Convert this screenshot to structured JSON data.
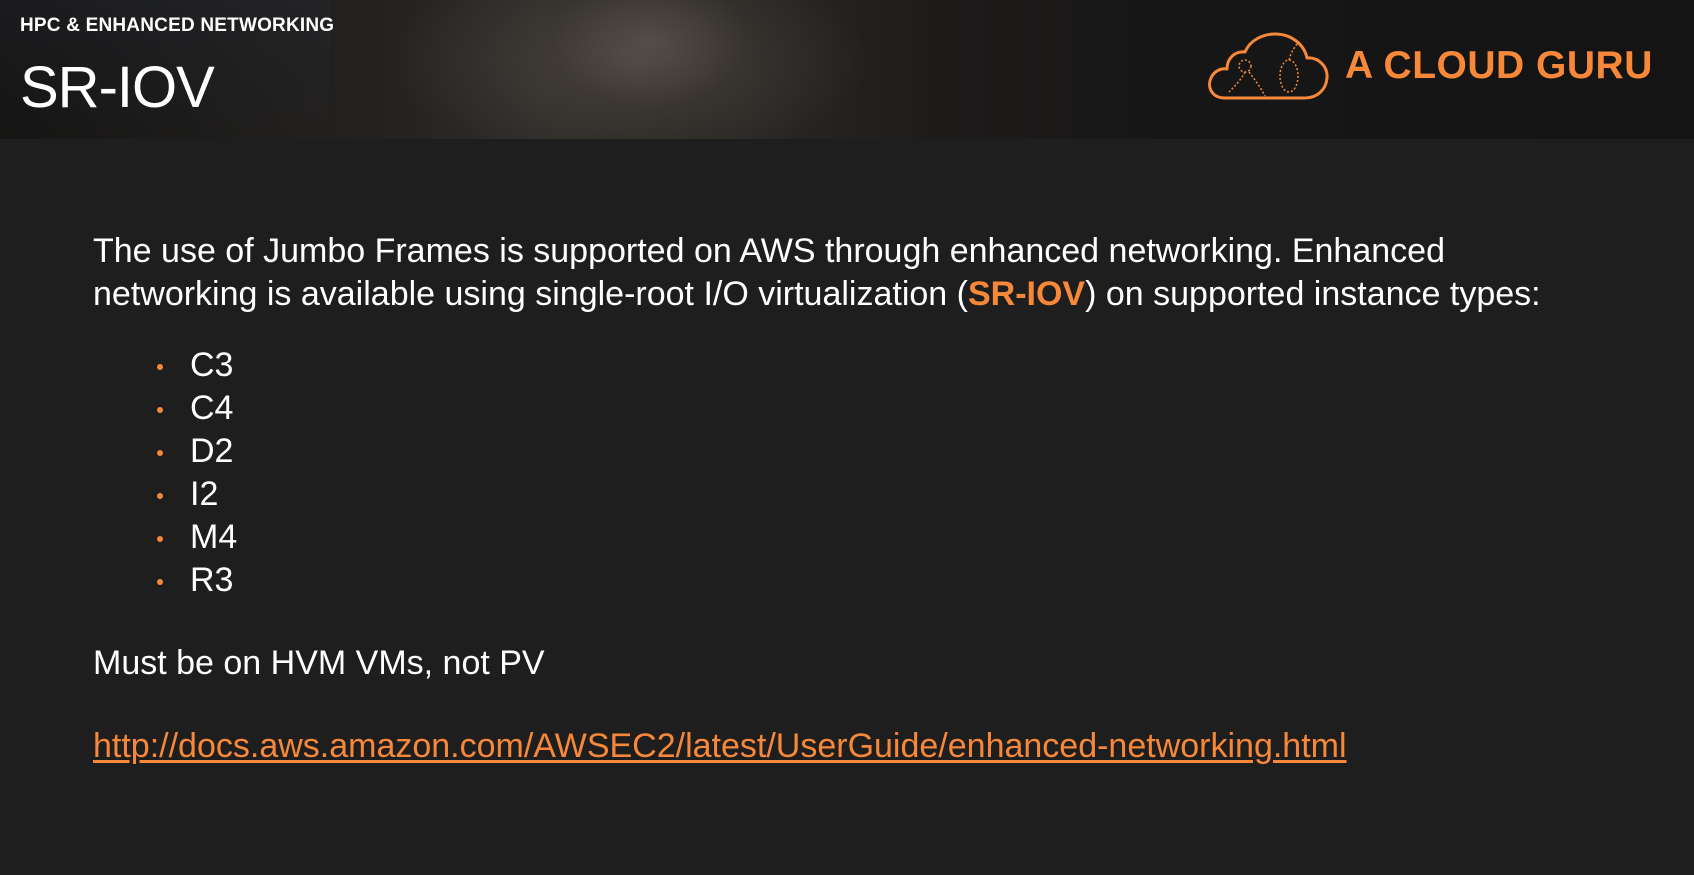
{
  "header": {
    "kicker": "HPC & ENHANCED NETWORKING",
    "title": "SR-IOV"
  },
  "brand": {
    "name": "A CLOUD GURU",
    "icon": "cloud-logo-icon",
    "color": "#f7883a"
  },
  "body": {
    "intro_before": "The use of Jumbo Frames is supported on AWS through enhanced networking. Enhanced networking is available using single-root I/O virtualization (",
    "intro_highlight": "SR-IOV",
    "intro_after": ") on supported instance types:",
    "instance_types": [
      "C3",
      "C4",
      "D2",
      "I2",
      "M4",
      "R3"
    ],
    "note": "Must be on HVM VMs, not PV",
    "link": "http://docs.aws.amazon.com/AWSEC2/latest/UserGuide/enhanced-networking.html"
  },
  "colors": {
    "accent": "#f7883a",
    "background": "#1e1e1e",
    "text": "#ffffff"
  }
}
